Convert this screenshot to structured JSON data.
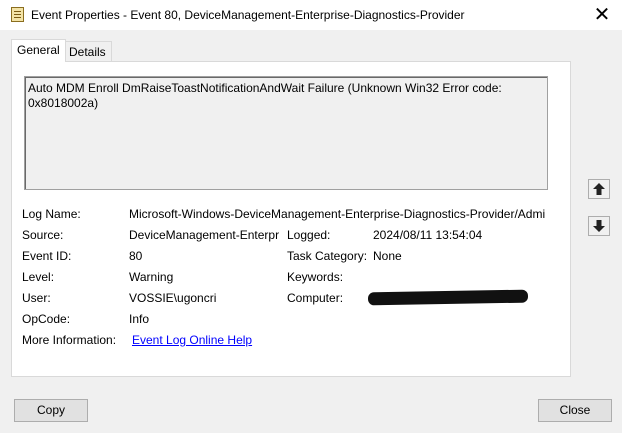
{
  "window": {
    "title": "Event Properties - Event 80, DeviceManagement-Enterprise-Diagnostics-Provider",
    "close_glyph": "✕"
  },
  "tabs": [
    {
      "label": "General",
      "active": true
    },
    {
      "label": "Details",
      "active": false
    }
  ],
  "description": "Auto MDM Enroll DmRaiseToastNotificationAndWait Failure (Unknown Win32 Error code: 0x8018002a)",
  "fields": {
    "log_name": {
      "label": "Log Name:",
      "value": "Microsoft-Windows-DeviceManagement-Enterprise-Diagnostics-Provider/Admi"
    },
    "source": {
      "label": "Source:",
      "value": "DeviceManagement-Enterpr"
    },
    "logged": {
      "label": "Logged:",
      "value": "2024/08/11 13:54:04"
    },
    "event_id": {
      "label": "Event ID:",
      "value": "80"
    },
    "task_category": {
      "label": "Task Category:",
      "value": "None"
    },
    "level": {
      "label": "Level:",
      "value": "Warning"
    },
    "keywords": {
      "label": "Keywords:",
      "value": ""
    },
    "user": {
      "label": "User:",
      "value": "VOSSIE\\ugoncri"
    },
    "computer": {
      "label": "Computer:",
      "value": ""
    },
    "opcode": {
      "label": "OpCode:",
      "value": "Info"
    },
    "more_info": {
      "label": "More Information:",
      "link": "Event Log Online Help"
    }
  },
  "buttons": {
    "copy": "Copy",
    "close": "Close"
  },
  "icons": {
    "title": "event-log-icon",
    "up": "arrow-up-icon",
    "down": "arrow-down-icon"
  }
}
